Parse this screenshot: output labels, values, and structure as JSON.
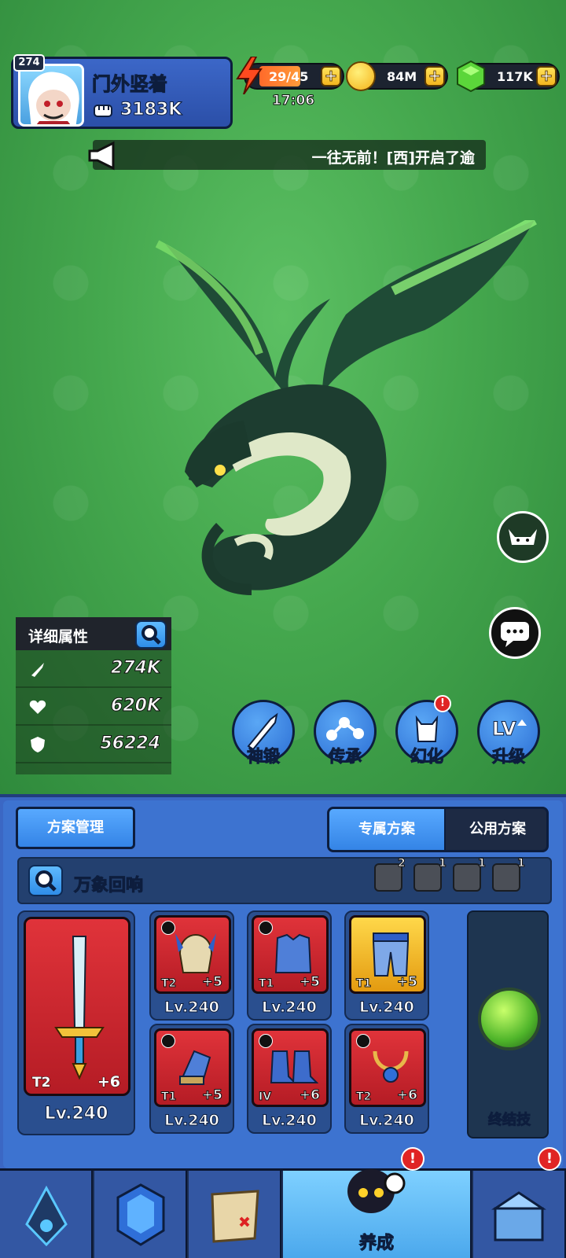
{
  "header": {
    "player_level": "274",
    "player_name": "门外竖着",
    "player_power": "3183K",
    "energy": "29/45",
    "energy_timer": "17:06",
    "gold": "84M",
    "gems": "117K",
    "plus_label": "+"
  },
  "announcement": {
    "text": "一往无前！[西]开启了逾"
  },
  "detail_stats": {
    "title": "详细属性",
    "attack": "274K",
    "hp": "620K",
    "defense": "56224"
  },
  "actions": [
    {
      "label": "神锻"
    },
    {
      "label": "传承"
    },
    {
      "label": "幻化",
      "badge": "!"
    },
    {
      "label": "升级"
    }
  ],
  "panel": {
    "scheme_manage": "方案管理",
    "tabs": {
      "exclusive": "专属方案",
      "public": "公用方案"
    },
    "set_name": "万象回响",
    "skill_counts": [
      "2",
      "1",
      "1",
      "1"
    ],
    "main_weapon": {
      "tier": "T2",
      "plus": "+6",
      "level": "Lv.240"
    },
    "equipment": [
      {
        "tier": "T2",
        "plus": "+5",
        "level": "Lv.240"
      },
      {
        "tier": "T1",
        "plus": "+5",
        "level": "Lv.240"
      },
      {
        "tier": "T1",
        "plus": "+5",
        "level": "Lv.240"
      },
      {
        "tier": "T1",
        "plus": "+5",
        "level": "Lv.240"
      },
      {
        "tier": "IV",
        "plus": "+6",
        "level": "Lv.240"
      },
      {
        "tier": "T2",
        "plus": "+6",
        "level": "Lv.240"
      }
    ],
    "ultimate_label": "终结技"
  },
  "nav": {
    "active_label": "养成",
    "badge": "!"
  },
  "colors": {
    "background": "#45a84e",
    "panel_blue": "#3d73d0",
    "card_red": "#c82229",
    "accent_gold": "#f2b51f"
  }
}
